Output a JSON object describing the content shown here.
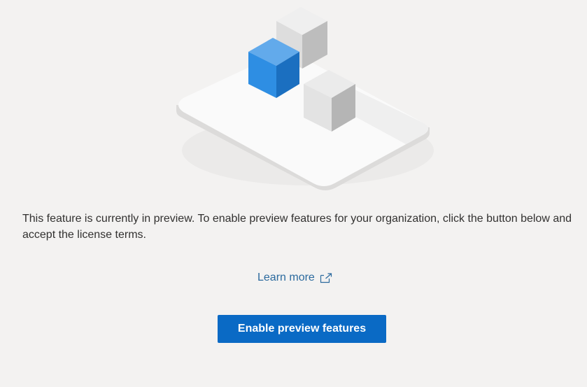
{
  "description": "This feature is currently in preview. To enable preview features for your organization, click the button below and accept the license terms.",
  "learn_more": {
    "label": "Learn more",
    "icon": "external-link-icon"
  },
  "enable_button": {
    "label": "Enable preview features"
  },
  "colors": {
    "background": "#f3f2f1",
    "link": "#2b6a9e",
    "button": "#0a6ac5",
    "accent_cube": "#2e8ee3"
  }
}
